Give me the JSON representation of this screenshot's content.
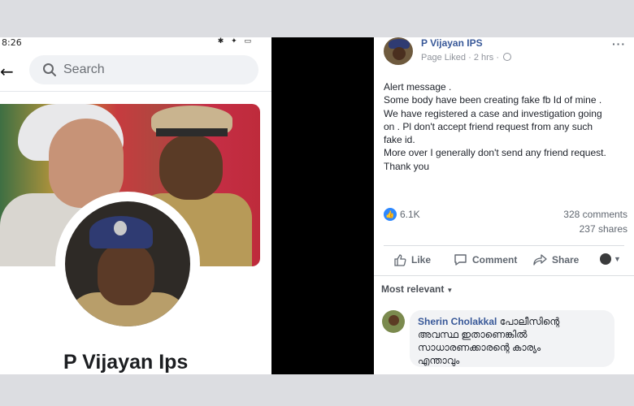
{
  "left_screenshot": {
    "status_time": "8:26",
    "search_placeholder": "Search",
    "profile_name": "P Vijayan Ips"
  },
  "post": {
    "author": "P Vijayan IPS",
    "meta": "Page Liked · 2 hrs ·",
    "lines": [
      "Alert message .",
      "Some body have been creating fake fb Id of mine .",
      "We have registered a case and investigation going",
      "on . Pl don't accept friend request from any such",
      "fake id.",
      "More over I generally don't send any friend request.",
      "Thank you"
    ],
    "reaction_count": "6.1K",
    "comments_count": "328 comments",
    "shares_count": "237 shares",
    "actions": {
      "like": "Like",
      "comment": "Comment",
      "share": "Share"
    },
    "sort_label": "Most relevant",
    "comment": {
      "name": "Sherin Cholakkal",
      "text_first": "പോലീസിന്റെ",
      "text_lines": [
        "അവസ്ഥ ഇതാണെങ്കിൽ",
        "സാധാരണക്കാരന്റെ കാര്യം",
        "എന്താവും"
      ]
    }
  },
  "colors": {
    "facebook_link": "#385898",
    "like_blue": "#2d88ff",
    "background": "#dcdde1"
  }
}
